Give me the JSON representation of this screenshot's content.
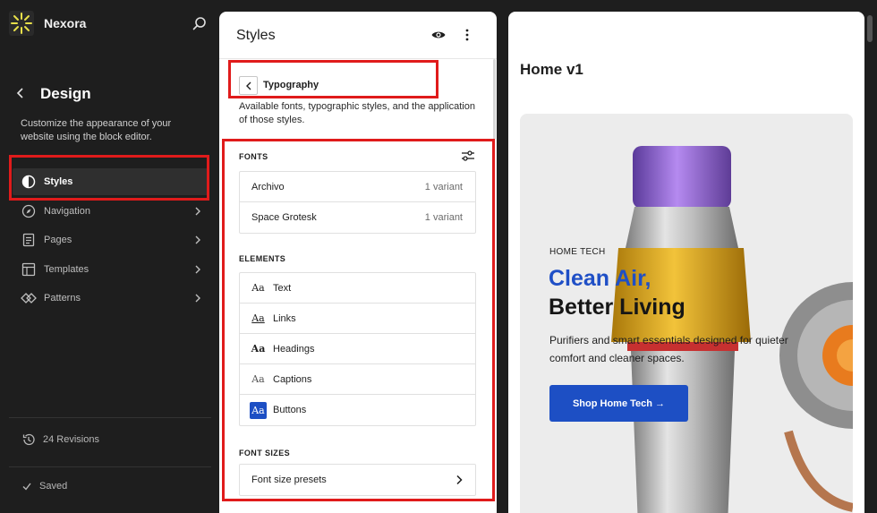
{
  "sidebar": {
    "brand": "Nexora",
    "title": "Design",
    "description": "Customize the appearance of your website using the block editor.",
    "items": [
      {
        "label": "Styles",
        "icon": "half-circle-icon"
      },
      {
        "label": "Navigation",
        "icon": "compass-icon"
      },
      {
        "label": "Pages",
        "icon": "page-icon"
      },
      {
        "label": "Templates",
        "icon": "layout-icon"
      },
      {
        "label": "Patterns",
        "icon": "diamond-icon"
      }
    ],
    "revisions": "24 Revisions",
    "saved": "Saved"
  },
  "styles_panel": {
    "title": "Styles",
    "typography": {
      "title": "Typography",
      "description": "Available fonts, typographic styles, and the application of those styles."
    },
    "fonts_label": "FONTS",
    "fonts": [
      {
        "name": "Archivo",
        "meta": "1 variant"
      },
      {
        "name": "Space Grotesk",
        "meta": "1 variant"
      }
    ],
    "elements_label": "ELEMENTS",
    "elements": [
      {
        "glyph": "Aa",
        "label": "Text"
      },
      {
        "glyph": "Aa",
        "label": "Links"
      },
      {
        "glyph": "Aa",
        "label": "Headings"
      },
      {
        "glyph": "Aa",
        "label": "Captions"
      },
      {
        "glyph": "Aa",
        "label": "Buttons"
      }
    ],
    "font_sizes_label": "FONT SIZES",
    "font_size_presets": "Font size presets"
  },
  "preview": {
    "title": "Home v1",
    "eyebrow": "HOME TECH",
    "headline_1": "Clean Air,",
    "headline_2": "Better Living",
    "description": "Purifiers and smart essentials designed for quieter comfort and cleaner spaces.",
    "cta": "Shop Home Tech →"
  },
  "colors": {
    "accent": "#1d4fc4",
    "annotation": "#e01b1b",
    "sidebar_bg": "#1e1e1e"
  }
}
